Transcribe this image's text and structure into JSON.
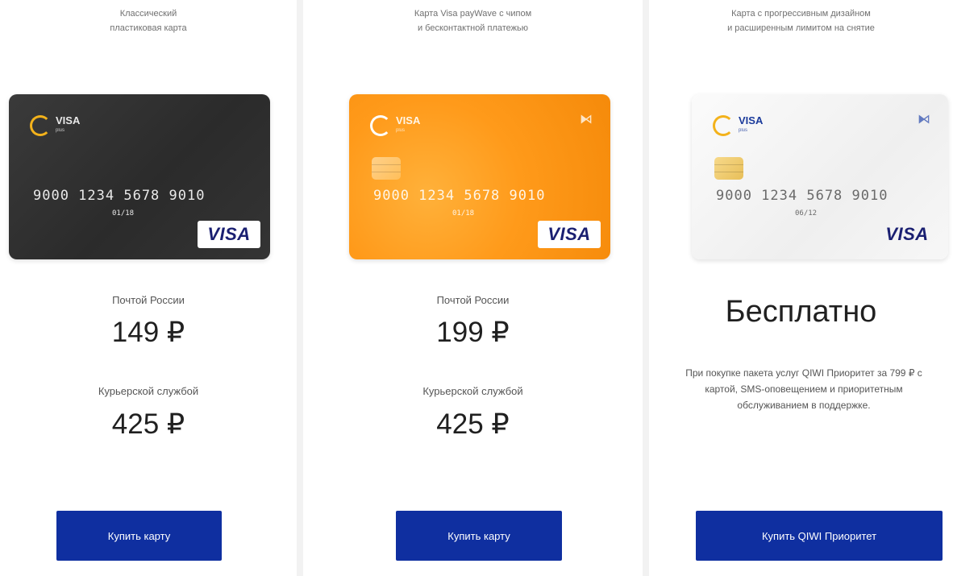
{
  "cards": [
    {
      "description": [
        "Классический",
        "пластиковая карта"
      ],
      "card_face": {
        "brand": "VISA",
        "brand_sub": "plus",
        "number": "9000 1234 5678 9010",
        "expiry": "01/18",
        "holder": "",
        "network": "VISA",
        "theme_color": "#2f2f2f"
      },
      "delivery_post_label": "Почтой России",
      "delivery_post_price": "149 ₽",
      "delivery_courier_label": "Курьерской службой",
      "delivery_courier_price": "425 ₽",
      "button_label": "Купить карту"
    },
    {
      "description": [
        "Карта Visa payWave с чипом",
        "и бесконтактной платежью"
      ],
      "card_face": {
        "brand": "VISA",
        "brand_sub": "plus",
        "number": "9000 1234 5678 9010",
        "expiry": "01/18",
        "holder": "",
        "network": "VISA",
        "theme_color": "#ff9a1a"
      },
      "delivery_post_label": "Почтой России",
      "delivery_post_price": "199 ₽",
      "delivery_courier_label": "Курьерской службой",
      "delivery_courier_price": "425 ₽",
      "button_label": "Купить карту"
    },
    {
      "description": [
        "Карта с прогрессивным дизайном",
        "и расширенным лимитом на снятие"
      ],
      "card_face": {
        "brand": "VISA",
        "brand_sub": "plus",
        "number": "9000 1234 5678 9010",
        "expiry": "06/12",
        "holder": "",
        "network": "VISA",
        "theme_color": "#f2f2f2"
      },
      "free_title": "Бесплатно",
      "free_note": "При покупке пакета услуг QIWI Приоритет за 799 ₽ с картой, SMS-оповещением и приоритетным обслуживанием в поддержке.",
      "button_label": "Купить QIWI Приоритет"
    }
  ],
  "colors": {
    "button": "#0f2fa0",
    "logo_ring": "#f3b21b",
    "visa_blue": "#1a1f71",
    "gutter": "#f2f2f2"
  },
  "icons": {
    "logo": "qiwi-logo-icon",
    "chip": "chip-icon",
    "contactless": "contactless-icon"
  }
}
